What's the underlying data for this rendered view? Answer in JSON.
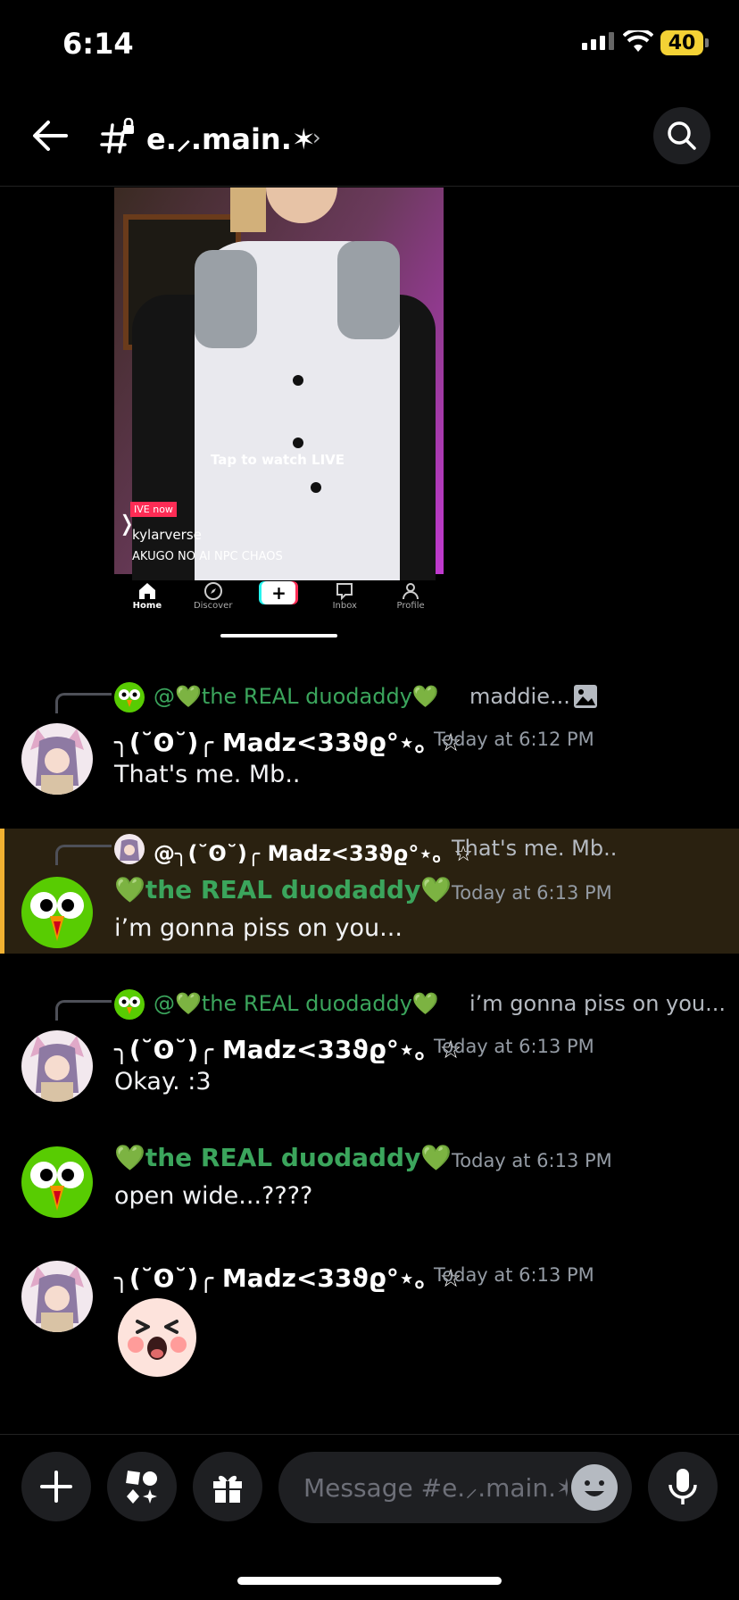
{
  "status_bar": {
    "time": "6:14",
    "battery": "40"
  },
  "header": {
    "channel_name": "e.⸝.main.✶",
    "chevron": "›"
  },
  "embed": {
    "tap_to_watch": "Tap to watch LIVE",
    "live_now": "IVE now",
    "live_user": "kylarverse",
    "live_title": "AKUGO NO AI NPC CHAOS",
    "nav": {
      "home": "Home",
      "discover": "Discover",
      "inbox": "Inbox",
      "profile": "Profile"
    }
  },
  "users": {
    "madz": "╮(˘ʘ˘)╭ Madz<33ϑϱ°⋆。☆",
    "duo": "💚the REAL duodaddy💚"
  },
  "messages": [
    {
      "reply_mention": "@💚the REAL duodaddy💚",
      "reply_preview": "maddie...",
      "author": "madz",
      "timestamp": "Today at 6:12 PM",
      "text": "That's me. Mb.."
    },
    {
      "reply_mention": "@╮(˘ʘ˘)╭ Madz<33ϑϱ°⋆。☆",
      "reply_preview": "That's me. Mb..",
      "author": "duo",
      "timestamp": "Today at 6:13 PM",
      "text": "i’m gonna piss on you..."
    },
    {
      "reply_mention": "@💚the REAL duodaddy💚",
      "reply_preview": "i’m gonna piss on you...",
      "author": "madz",
      "timestamp": "Today at 6:13 PM",
      "text": "Okay. :3"
    },
    {
      "author": "duo",
      "timestamp": "Today at 6:13 PM",
      "text": "open wide...????"
    },
    {
      "author": "madz",
      "timestamp": "Today at 6:13 PM",
      "sticker": "yelling-face-sticker"
    }
  ],
  "composer": {
    "placeholder": "Message #e.⸝.main.✶"
  },
  "colors": {
    "accent_green": "#3ba55c",
    "highlight_bar": "#f0b132",
    "highlight_bg": "#2a2110"
  }
}
